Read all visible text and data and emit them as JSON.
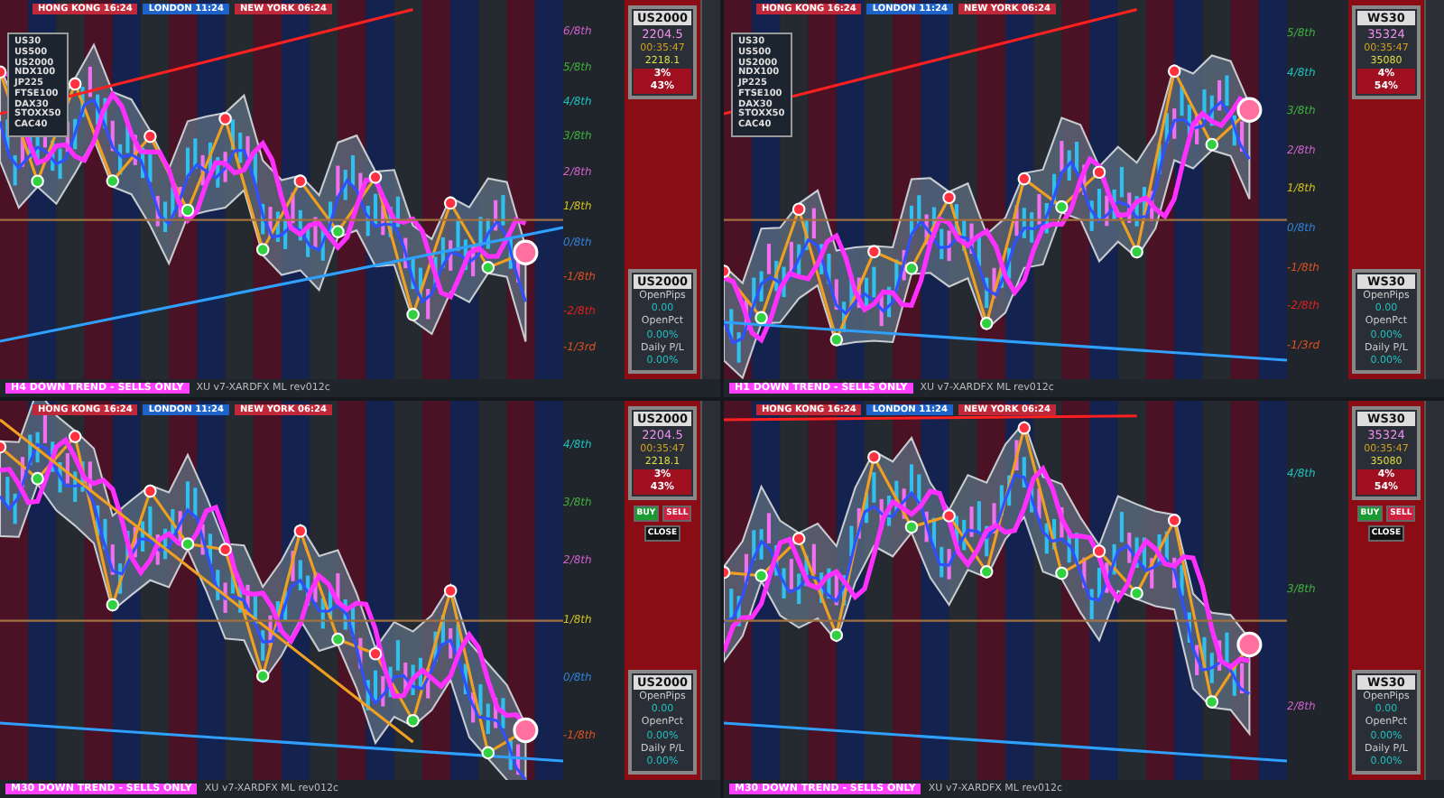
{
  "panels": [
    {
      "sessions": [
        {
          "label": "HONG KONG 16:24",
          "color": "#c0283a"
        },
        {
          "label": "LONDON 11:24",
          "color": "#1d63c9"
        },
        {
          "label": "NEW YORK 06:24",
          "color": "#c0283a"
        }
      ],
      "symbols": [
        "US30",
        "US500",
        "US2000",
        "NDX100",
        "JP225",
        "FTSE100",
        "DAX30",
        "STOXX50",
        "CAC40"
      ],
      "levels": [
        {
          "label": "6/8th",
          "color": "#d060d0"
        },
        {
          "label": "5/8th",
          "color": "#40b040"
        },
        {
          "label": "4/8th",
          "color": "#20c0c0"
        },
        {
          "label": "3/8th",
          "color": "#40b040"
        },
        {
          "label": "2/8th",
          "color": "#d060d0"
        },
        {
          "label": "1/8th",
          "color": "#d0c020"
        },
        {
          "label": "0/8th",
          "color": "#3080e0"
        },
        {
          "label": "-1/8th",
          "color": "#e05020"
        },
        {
          "label": "-2/8th",
          "color": "#e02020"
        },
        {
          "label": "-1/3rd",
          "color": "#e05020"
        }
      ],
      "info": {
        "symbol": "US2000",
        "price": "2204.5",
        "time": "00:35:47",
        "open": "2218.1",
        "risk": "3%",
        "adr": "43%"
      },
      "pl": {
        "symbol": "US2000",
        "pips_label": "OpenPips",
        "pips": "0.00",
        "pct_label": "OpenPct",
        "pct": "0.00%",
        "daily_label": "Daily P/L",
        "daily": "0.00%"
      },
      "trend": "H4 DOWN TREND - SELLS ONLY",
      "indicator": "XU v7-XARDFX ML rev012c"
    },
    {
      "sessions": [
        {
          "label": "HONG KONG 16:24",
          "color": "#c0283a"
        },
        {
          "label": "LONDON 11:24",
          "color": "#1d63c9"
        },
        {
          "label": "NEW YORK 06:24",
          "color": "#c0283a"
        }
      ],
      "symbols": [
        "US30",
        "US500",
        "US2000",
        "NDX100",
        "JP225",
        "FTSE100",
        "DAX30",
        "STOXX50",
        "CAC40"
      ],
      "levels": [
        {
          "label": "5/8th",
          "color": "#40b040"
        },
        {
          "label": "4/8th",
          "color": "#20c0c0"
        },
        {
          "label": "3/8th",
          "color": "#40b040"
        },
        {
          "label": "2/8th",
          "color": "#d060d0"
        },
        {
          "label": "1/8th",
          "color": "#d0c020"
        },
        {
          "label": "0/8th",
          "color": "#3080e0"
        },
        {
          "label": "-1/8th",
          "color": "#e05020"
        },
        {
          "label": "-2/8th",
          "color": "#e02020"
        },
        {
          "label": "-1/3rd",
          "color": "#e05020"
        }
      ],
      "info": {
        "symbol": "WS30",
        "price": "35324",
        "time": "00:35:47",
        "open": "35080",
        "risk": "4%",
        "adr": "54%"
      },
      "pl": {
        "symbol": "WS30",
        "pips_label": "OpenPips",
        "pips": "0.00",
        "pct_label": "OpenPct",
        "pct": "0.00%",
        "daily_label": "Daily P/L",
        "daily": "0.00%"
      },
      "trend": "H1 DOWN TREND - SELLS ONLY",
      "indicator": "XU v7-XARDFX ML rev012c"
    },
    {
      "sessions": [
        {
          "label": "HONG KONG 16:24",
          "color": "#c0283a"
        },
        {
          "label": "LONDON 11:24",
          "color": "#1d63c9"
        },
        {
          "label": "NEW YORK 06:24",
          "color": "#c0283a"
        }
      ],
      "levels": [
        {
          "label": "4/8th",
          "color": "#20c0c0"
        },
        {
          "label": "3/8th",
          "color": "#40b040"
        },
        {
          "label": "2/8th",
          "color": "#d060d0"
        },
        {
          "label": "1/8th",
          "color": "#d0c020"
        },
        {
          "label": "0/8th",
          "color": "#3080e0"
        },
        {
          "label": "-1/8th",
          "color": "#e05020"
        }
      ],
      "info": {
        "symbol": "US2000",
        "price": "2204.5",
        "time": "00:35:47",
        "open": "2218.1",
        "risk": "3%",
        "adr": "43%"
      },
      "buttons": [
        "BUY",
        "SELL",
        "CLOSE"
      ],
      "pl": {
        "symbol": "US2000",
        "pips_label": "OpenPips",
        "pips": "0.00",
        "pct_label": "OpenPct",
        "pct": "0.00%",
        "daily_label": "Daily P/L",
        "daily": "0.00%"
      },
      "trend": "M30 DOWN TREND - SELLS ONLY",
      "indicator": "XU v7-XARDFX ML rev012c"
    },
    {
      "sessions": [
        {
          "label": "HONG KONG 16:24",
          "color": "#c0283a"
        },
        {
          "label": "LONDON 11:24",
          "color": "#1d63c9"
        },
        {
          "label": "NEW YORK 06:24",
          "color": "#c0283a"
        }
      ],
      "levels": [
        {
          "label": "4/8th",
          "color": "#20c0c0"
        },
        {
          "label": "3/8th",
          "color": "#40b040"
        },
        {
          "label": "2/8th",
          "color": "#d060d0"
        }
      ],
      "info": {
        "symbol": "WS30",
        "price": "35324",
        "time": "00:35:47",
        "open": "35080",
        "risk": "4%",
        "adr": "54%"
      },
      "buttons": [
        "BUY",
        "SELL",
        "CLOSE"
      ],
      "pl": {
        "symbol": "WS30",
        "pips_label": "OpenPips",
        "pips": "0.00",
        "pct_label": "OpenPct",
        "pct": "0.00%",
        "daily_label": "Daily P/L",
        "daily": "0.00%"
      },
      "trend": "M30 DOWN TREND - SELLS ONLY",
      "indicator": "XU v7-XARDFX ML rev012c"
    }
  ]
}
